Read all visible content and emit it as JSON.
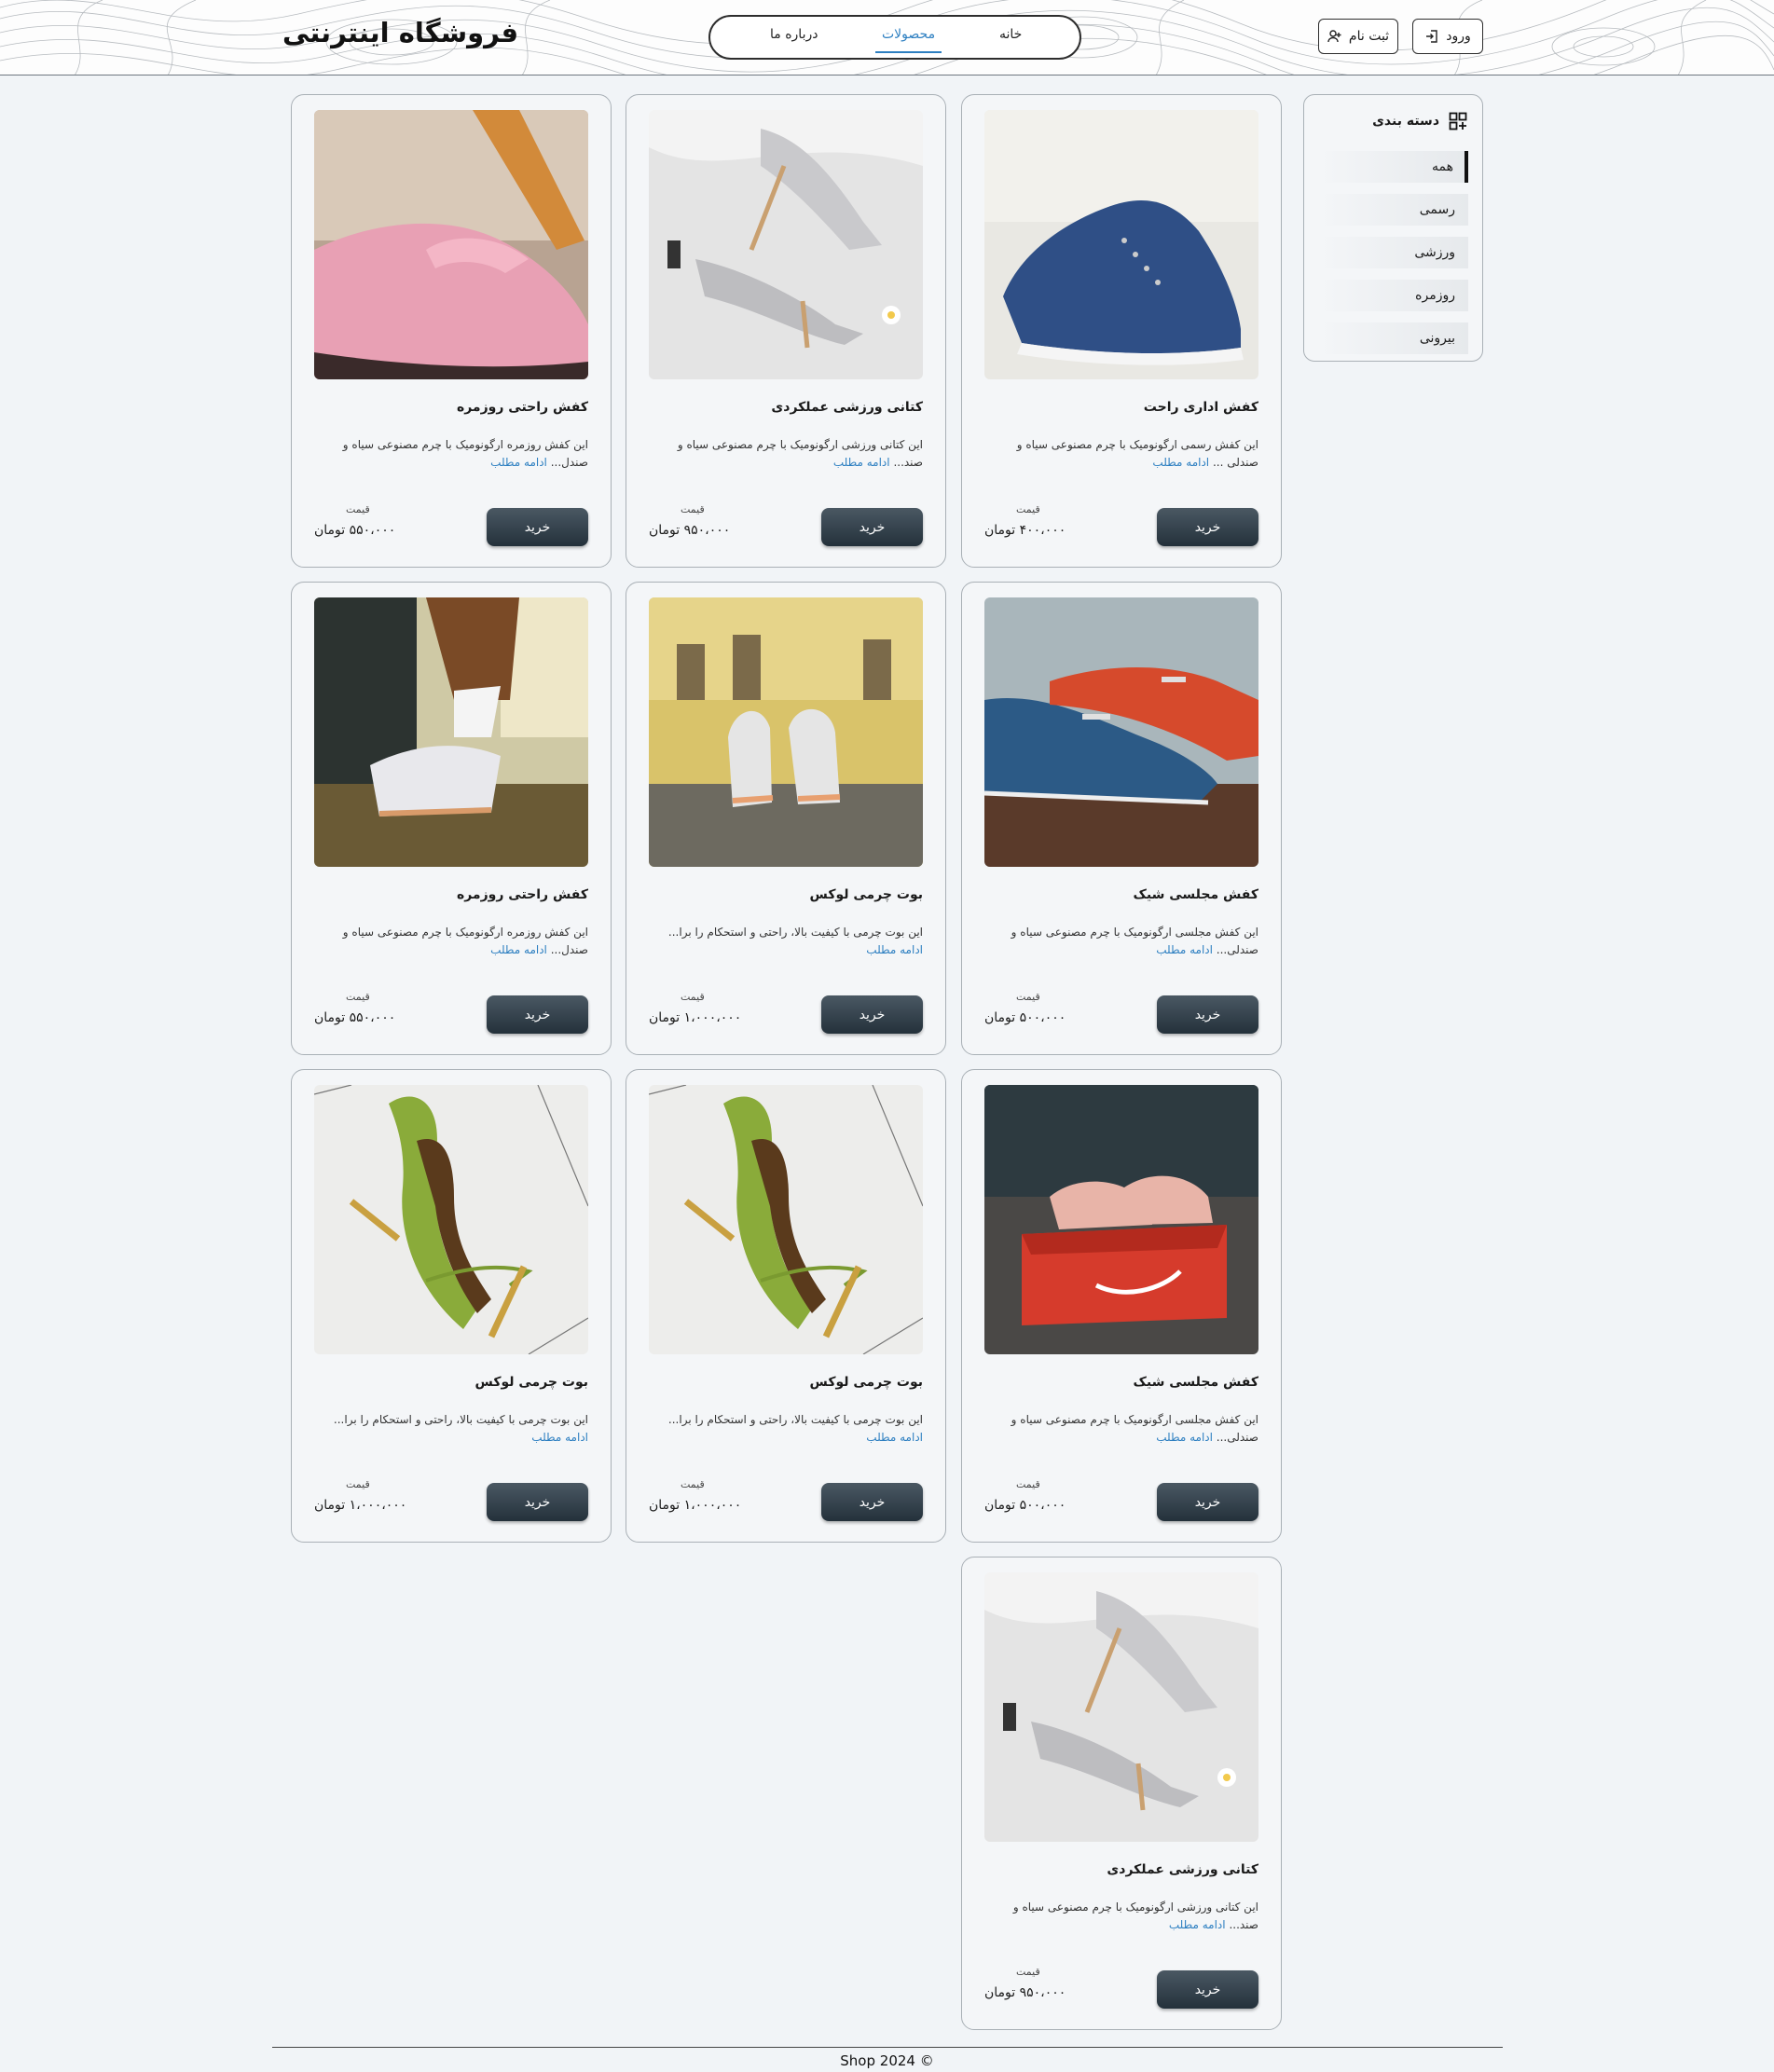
{
  "header": {
    "site_title": "فروشگاه اینترنتی",
    "nav": [
      {
        "label": "خانه",
        "active": false
      },
      {
        "label": "محصولات",
        "active": true
      },
      {
        "label": "درباره ما",
        "active": false
      }
    ],
    "login_label": "ورود",
    "register_label": "ثبت نام"
  },
  "sidebar": {
    "title": "دسته بندی",
    "categories": [
      {
        "label": "همه",
        "active": true
      },
      {
        "label": "رسمی",
        "active": false
      },
      {
        "label": "ورزشی",
        "active": false
      },
      {
        "label": "روزمره",
        "active": false
      },
      {
        "label": "بیرونی",
        "active": false
      }
    ]
  },
  "products": [
    {
      "title": "کفش اداری راحت",
      "desc": "این کفش رسمی ارگونومیک با چرم مصنوعی سیاه و صندلی ...",
      "more": "ادامه مطلب",
      "price_label": "قیمت",
      "price": "۴۰۰،۰۰۰ تومان",
      "buy": "خرید",
      "image": "blue-sneaker"
    },
    {
      "title": "کتانی ورزشی عملکردی",
      "desc": "این کتانی ورزشی ارگونومیک با چرم مصنوعی سیاه و صند...",
      "more": "ادامه مطلب",
      "price_label": "قیمت",
      "price": "۹۵۰،۰۰۰ تومان",
      "buy": "خرید",
      "image": "silver-heels"
    },
    {
      "title": "کفش راحتی روزمره",
      "desc": "این کفش روزمره ارگونومیک با چرم مصنوعی سیاه و صندل...",
      "more": "ادامه مطلب",
      "price_label": "قیمت",
      "price": "۵۵۰،۰۰۰ تومان",
      "buy": "خرید",
      "image": "pink-flat"
    },
    {
      "title": "کفش مجلسی شیک",
      "desc": "این کفش مجلسی ارگونومیک با چرم مصنوعی سیاه و صندلی...",
      "more": "ادامه مطلب",
      "price_label": "قیمت",
      "price": "۵۰۰،۰۰۰ تومان",
      "buy": "خرید",
      "image": "loafers"
    },
    {
      "title": "بوت چرمی لوکس",
      "desc": "این بوت چرمی با کیفیت بالا، راحتی و استحکام را برا...",
      "more": "ادامه مطلب",
      "price_label": "قیمت",
      "price": "۱،۰۰۰،۰۰۰ تومان",
      "buy": "خرید",
      "image": "white-sneakers"
    },
    {
      "title": "کفش راحتی روزمره",
      "desc": "این کفش روزمره ارگونومیک با چرم مصنوعی سیاه و صندل...",
      "more": "ادامه مطلب",
      "price_label": "قیمت",
      "price": "۵۵۰،۰۰۰ تومان",
      "buy": "خرید",
      "image": "walking-sneaker"
    },
    {
      "title": "کفش مجلسی شیک",
      "desc": "این کفش مجلسی ارگونومیک با چرم مصنوعی سیاه و صندلی...",
      "more": "ادامه مطلب",
      "price_label": "قیمت",
      "price": "۵۰۰،۰۰۰ تومان",
      "buy": "خرید",
      "image": "nike-box"
    },
    {
      "title": "بوت چرمی لوکس",
      "desc": "این بوت چرمی با کیفیت بالا، راحتی و استحکام را برا...",
      "more": "ادامه مطلب",
      "price_label": "قیمت",
      "price": "۱،۰۰۰،۰۰۰ تومان",
      "buy": "خرید",
      "image": "green-heels"
    },
    {
      "title": "بوت چرمی لوکس",
      "desc": "این بوت چرمی با کیفیت بالا، راحتی و استحکام را برا...",
      "more": "ادامه مطلب",
      "price_label": "قیمت",
      "price": "۱،۰۰۰،۰۰۰ تومان",
      "buy": "خرید",
      "image": "green-heels"
    },
    {
      "title": "کتانی ورزشی عملکردی",
      "desc": "این کتانی ورزشی ارگونومیک با چرم مصنوعی سیاه و صند...",
      "more": "ادامه مطلب",
      "price_label": "قیمت",
      "price": "۹۵۰،۰۰۰ تومان",
      "buy": "خرید",
      "image": "silver-heels"
    }
  ],
  "footer": {
    "text": "Shop 2024 ©"
  }
}
